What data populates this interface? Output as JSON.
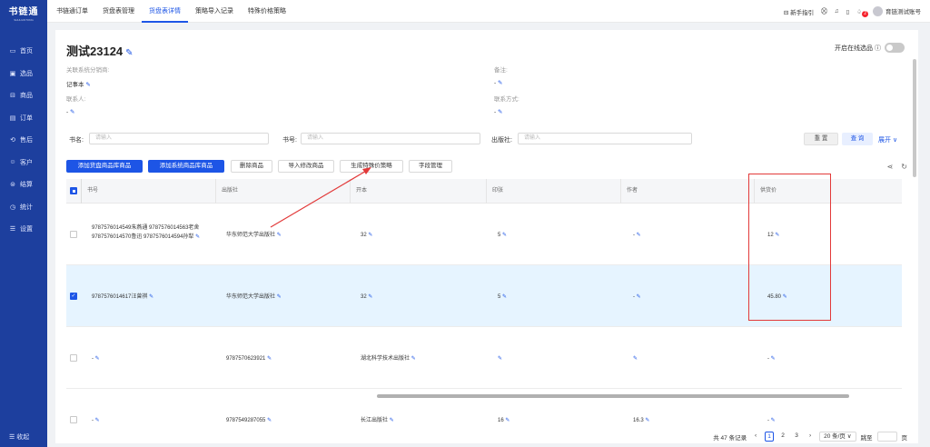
{
  "app": {
    "logo_text": "书链通",
    "logo_sub": "SHULIANTONG"
  },
  "sidebar": {
    "items": [
      {
        "label": "首页",
        "icon": "home-icon",
        "glyph": "▭"
      },
      {
        "label": "选品",
        "icon": "select-icon",
        "glyph": "▣"
      },
      {
        "label": "商品",
        "icon": "goods-icon",
        "glyph": "⊟"
      },
      {
        "label": "订单",
        "icon": "order-icon",
        "glyph": "▤"
      },
      {
        "label": "售后",
        "icon": "after-sale-icon",
        "glyph": "⟲"
      },
      {
        "label": "客户",
        "icon": "customer-icon",
        "glyph": "☺"
      },
      {
        "label": "结算",
        "icon": "settle-icon",
        "glyph": "⊜"
      },
      {
        "label": "统计",
        "icon": "stats-icon",
        "glyph": "◷"
      },
      {
        "label": "设置",
        "icon": "settings-icon",
        "glyph": "☰"
      }
    ],
    "collapse_label": "☰ 收起"
  },
  "topbar": {
    "tabs": [
      {
        "label": "书链通订单",
        "active": false
      },
      {
        "label": "货盘表管理",
        "active": false
      },
      {
        "label": "货盘表详情",
        "active": true
      },
      {
        "label": "策略导入记录",
        "active": false
      },
      {
        "label": "特殊价格策略",
        "active": false
      }
    ],
    "guide_label": "⊟ 新手指引",
    "icon_glyphs": [
      "⛒",
      "♫",
      "▯",
      "♤"
    ],
    "badge": "2",
    "account": "育链测试账号"
  },
  "detail": {
    "title": "测试23124",
    "online_toggle_label": "开启在线选品 ⓘ",
    "distributor_label": "关联系统分销商:",
    "distributor_value": "记事本",
    "remark_label": "备注:",
    "remark_value": "-",
    "contact_label": "联系人:",
    "contact_value": "-",
    "phone_label": "联系方式:",
    "phone_value": "-",
    "pencil": "✎"
  },
  "filters": {
    "title_label": "书名:",
    "title_placeholder": "请输入",
    "isbn_label": "书号:",
    "isbn_placeholder": "请输入",
    "publisher_label": "出版社:",
    "publisher_placeholder": "请输入",
    "reset_label": "重 置",
    "query_label": "查 询",
    "expand_label": "展开 ∨"
  },
  "actions": {
    "add_pallet_product": "添加货盘商品库商品",
    "add_system_product": "添加系统商品库商品",
    "delete_product": "删除商品",
    "import_modify": "导入修改商品",
    "gen_special_price": "生成特殊价策略",
    "field_manage": "字段管理",
    "share_icon": "⋖",
    "refresh_icon": "↻"
  },
  "table": {
    "headers": [
      "书号",
      "出版社",
      "开本",
      "印张",
      "作者",
      "供货价"
    ],
    "rows": [
      {
        "selected": false,
        "isbn": "9787576014549朱燕通 9787576014563老舍 9787576014570鲁迅 9787576014594孙犁",
        "publisher": "华东师范大学出版社",
        "format": "32",
        "sheets": "5",
        "author": "-",
        "price": "12"
      },
      {
        "selected": true,
        "isbn": "9787576014617汪曾祺",
        "publisher": "华东师范大学出版社",
        "format": "32",
        "sheets": "5",
        "author": "-",
        "price": "45.80"
      },
      {
        "selected": false,
        "isbn": "-",
        "publisher": "9787570623921",
        "format": "湖北科学技术出版社",
        "sheets": "",
        "author": "",
        "price": "-"
      },
      {
        "selected": false,
        "isbn": "-",
        "publisher": "9787549287055",
        "format": "长江出版社",
        "sheets": "16",
        "author": "16.3",
        "price": "-"
      }
    ],
    "check_mark": "✓"
  },
  "pagination": {
    "total_text": "共 47 条记录",
    "prev": "‹",
    "pages": [
      "1",
      "2",
      "3"
    ],
    "current": "1",
    "next": "›",
    "page_size": "20 条/页 ∨",
    "jump_label": "跳至",
    "jump_suffix": "页"
  },
  "annotation": {
    "color": "#e23a3a"
  },
  "colors": {
    "primary": "#1d55e6",
    "sidebar": "#1d3f9e",
    "selected_row": "#e6f4ff"
  }
}
